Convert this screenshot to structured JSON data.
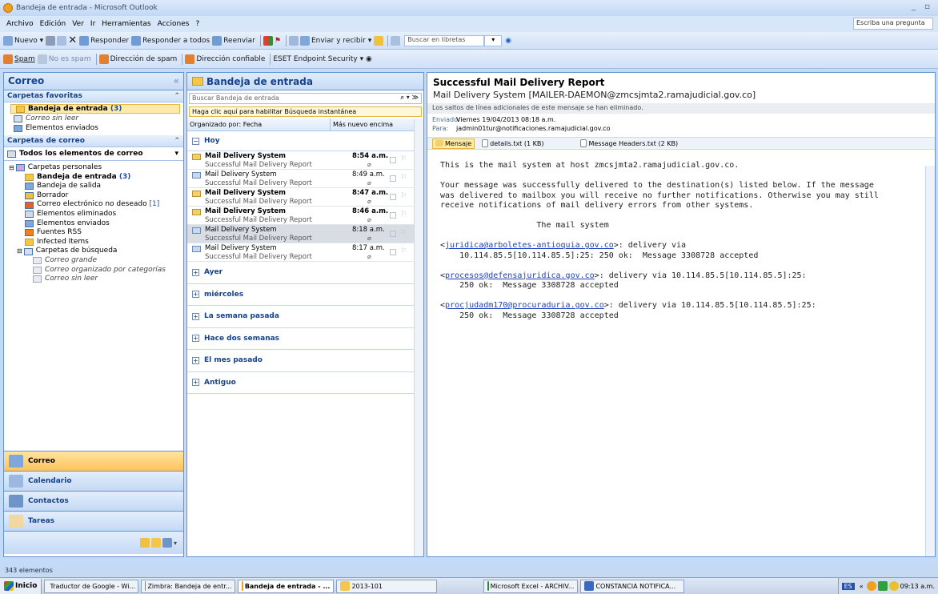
{
  "window": {
    "title": "Bandeja de entrada - Microsoft Outlook",
    "controls": "_ ▫"
  },
  "menu": {
    "items": [
      "Archivo",
      "Edición",
      "Ver",
      "Ir",
      "Herramientas",
      "Acciones",
      "?"
    ],
    "ask_placeholder": "Escriba una pregunta"
  },
  "toolbar1": {
    "nuevo": "Nuevo",
    "responder": "Responder",
    "responder_todos": "Responder a todos",
    "reenviar": "Reenviar",
    "enviar_recibir": "Enviar y recibir",
    "buscar_libretas": "Buscar en libretas"
  },
  "toolbar2": {
    "spam": "Spam",
    "no_spam": "No es spam",
    "dir_spam": "Dirección de spam",
    "dir_confiable": "Dirección confiable",
    "eset": "ESET Endpoint Security"
  },
  "nav": {
    "header": "Correo",
    "favorites_title": "Carpetas favoritas",
    "favorites": [
      {
        "label": "Bandeja de entrada",
        "count": "(3)",
        "style": "selected"
      },
      {
        "label": "Correo sin leer",
        "style": "italic"
      },
      {
        "label": "Elementos enviados",
        "style": "normal"
      }
    ],
    "folders_title": "Carpetas de correo",
    "all_items": "Todos los elementos de correo",
    "tree": [
      {
        "label": "Carpetas personales",
        "level": 0
      },
      {
        "label": "Bandeja de entrada",
        "count": "(3)",
        "level": 1,
        "bold": true
      },
      {
        "label": "Bandeja de salida",
        "level": 1
      },
      {
        "label": "Borrador",
        "level": 1
      },
      {
        "label": "Correo electrónico no deseado",
        "count": "[1]",
        "level": 1
      },
      {
        "label": "Elementos eliminados",
        "level": 1
      },
      {
        "label": "Elementos enviados",
        "level": 1
      },
      {
        "label": "Fuentes RSS",
        "level": 1
      },
      {
        "label": "Infected Items",
        "level": 1
      },
      {
        "label": "Carpetas de búsqueda",
        "level": 1
      },
      {
        "label": "Correo grande",
        "level": 2
      },
      {
        "label": "Correo organizado por categorías",
        "level": 2
      },
      {
        "label": "Correo sin leer",
        "level": 2
      }
    ],
    "buttons": [
      "Correo",
      "Calendario",
      "Contactos",
      "Tareas"
    ]
  },
  "list": {
    "header": "Bandeja de entrada",
    "search_placeholder": "Buscar Bandeja de entrada",
    "instant": "Haga clic aquí para habilitar Búsqueda instantánea",
    "arranged_by": "Organizado por: Fecha",
    "order": "Más nuevo encima",
    "today_group": "Hoy",
    "messages": [
      {
        "from": "Mail Delivery System",
        "subject": "Successful Mail Delivery Report",
        "time": "8:54 a.m.",
        "unread": true
      },
      {
        "from": "Mail Delivery System",
        "subject": "Successful Mail Delivery Report",
        "time": "8:49 a.m.",
        "unread": false
      },
      {
        "from": "Mail Delivery System",
        "subject": "Successful Mail Delivery Report",
        "time": "8:47 a.m.",
        "unread": true
      },
      {
        "from": "Mail Delivery System",
        "subject": "Successful Mail Delivery Report",
        "time": "8:46 a.m.",
        "unread": true
      },
      {
        "from": "Mail Delivery System",
        "subject": "Successful Mail Delivery Report",
        "time": "8:18 a.m.",
        "unread": false,
        "selected": true
      },
      {
        "from": "Mail Delivery System",
        "subject": "Successful Mail Delivery Report",
        "time": "8:17 a.m.",
        "unread": false
      }
    ],
    "other_groups": [
      "Ayer",
      "miércoles",
      "La semana pasada",
      "Hace dos semanas",
      "El mes pasado",
      "Antiguo"
    ]
  },
  "reading": {
    "subject": "Successful Mail Delivery Report",
    "from": "Mail Delivery System [MAILER-DAEMON@zmcsjmta2.ramajudicial.gov.co]",
    "info": "Los saltos de línea adicionales de este mensaje se han eliminado.",
    "sent_label": "Enviado:",
    "sent": "Viernes 19/04/2013 08:18 a.m.",
    "to_label": "Para:",
    "to": "jadmin01tur@notificaciones.ramajudicial.gov.co",
    "attachments": [
      "Mensaje",
      "details.txt (1 KB)",
      "Message Headers.txt (2 KB)"
    ],
    "line1": "This is the mail system at host zmcsjmta2.ramajudicial.gov.co.",
    "para2": "Your message was successfully delivered to the destination(s) listed below. If the message\nwas delivered to mailbox you will receive no further notifications. Otherwise you may still\nreceive notifications of mail delivery errors from other systems.",
    "sig": "                    The mail system",
    "r1_addr": "juridica@arboletes-antioquia.gov.co",
    "r1_a": ">: delivery via",
    "r1_b": "    10.114.85.5[10.114.85.5]:25: 250 ok:  Message 3308728 accepted",
    "r2_addr": "procesos@defensajuridica.gov.co",
    "r2_a": ">: delivery via 10.114.85.5[10.114.85.5]:25:",
    "r2_b": "    250 ok:  Message 3308728 accepted",
    "r3_addr": "procjudadm170@procuraduria.gov.co",
    "r3_a": ">: delivery via 10.114.85.5[10.114.85.5]:25:",
    "r3_b": "    250 ok:  Message 3308728 accepted"
  },
  "status": {
    "count": "343 elementos"
  },
  "taskbar": {
    "start": "Inicio",
    "tasks": [
      "Traductor de Google - Wi...",
      "Zimbra: Bandeja de entr...",
      "Bandeja de entrada - ...",
      "2013-101",
      "Microsoft Excel - ARCHIV...",
      "CONSTANCIA NOTIFICA..."
    ],
    "lang": "ES",
    "clock": "09:13 a.m."
  }
}
